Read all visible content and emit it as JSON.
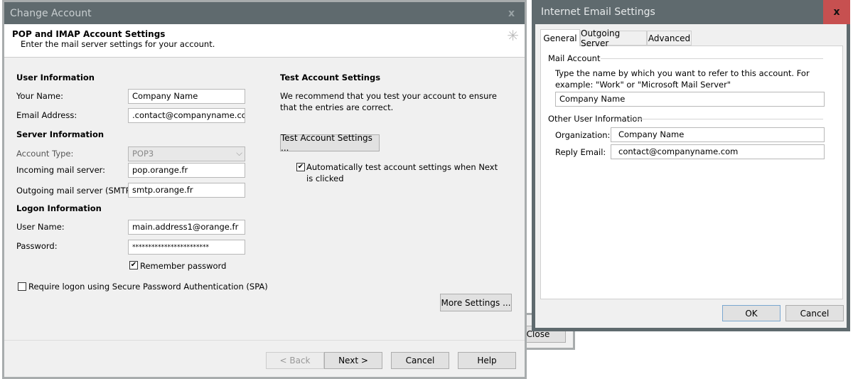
{
  "background_window": {
    "close_label": "Close"
  },
  "change_account": {
    "title": "Change Account",
    "close_glyph": "x",
    "header_title": "POP and IMAP Account Settings",
    "header_subtitle": "Enter the mail server settings for your account.",
    "user_info": {
      "heading": "User Information",
      "your_name_label": "Your Name:",
      "your_name": "Company Name",
      "email_label": "Email Address:",
      "email": ".contact@companyname.com"
    },
    "server_info": {
      "heading": "Server Information",
      "account_type_label": "Account Type:",
      "account_type": "POP3",
      "incoming_label": "Incoming mail server:",
      "incoming": "pop.orange.fr",
      "outgoing_label": "Outgoing mail server (SMTP):",
      "outgoing": "smtp.orange.fr"
    },
    "logon_info": {
      "heading": "Logon Information",
      "username_label": "User Name:",
      "username": "main.address1@orange.fr",
      "password_label": "Password:",
      "password": "************************",
      "remember_label": "Remember password",
      "remember_checked": true,
      "spa_label": "Require logon using Secure Password Authentication (SPA)",
      "spa_checked": false
    },
    "test": {
      "heading": "Test Account Settings",
      "description": "We recommend that you test your account to ensure that the entries are correct.",
      "button": "Test Account Settings ...",
      "auto_label": "Automatically test account settings when Next is clicked",
      "auto_checked": true
    },
    "more_settings": "More Settings ...",
    "footer": {
      "back": "< Back",
      "next": "Next >",
      "cancel": "Cancel",
      "help": "Help"
    }
  },
  "internet_email": {
    "title": "Internet Email Settings",
    "close_glyph": "x",
    "close_color": "#c75050",
    "tabs": [
      {
        "label": "General",
        "active": true
      },
      {
        "label": "Outgoing Server"
      },
      {
        "label": "Advanced"
      }
    ],
    "mail_account": {
      "heading": "Mail Account",
      "description": "Type the name by which you want to refer to this account. For example: \"Work\" or \"Microsoft Mail Server\"",
      "name": "Company Name"
    },
    "other_info": {
      "heading": "Other User Information",
      "organization_label": "Organization:",
      "organization": "Company Name",
      "reply_label": "Reply Email:",
      "reply": "contact@companyname.com"
    },
    "ok": "OK",
    "cancel": "Cancel"
  }
}
